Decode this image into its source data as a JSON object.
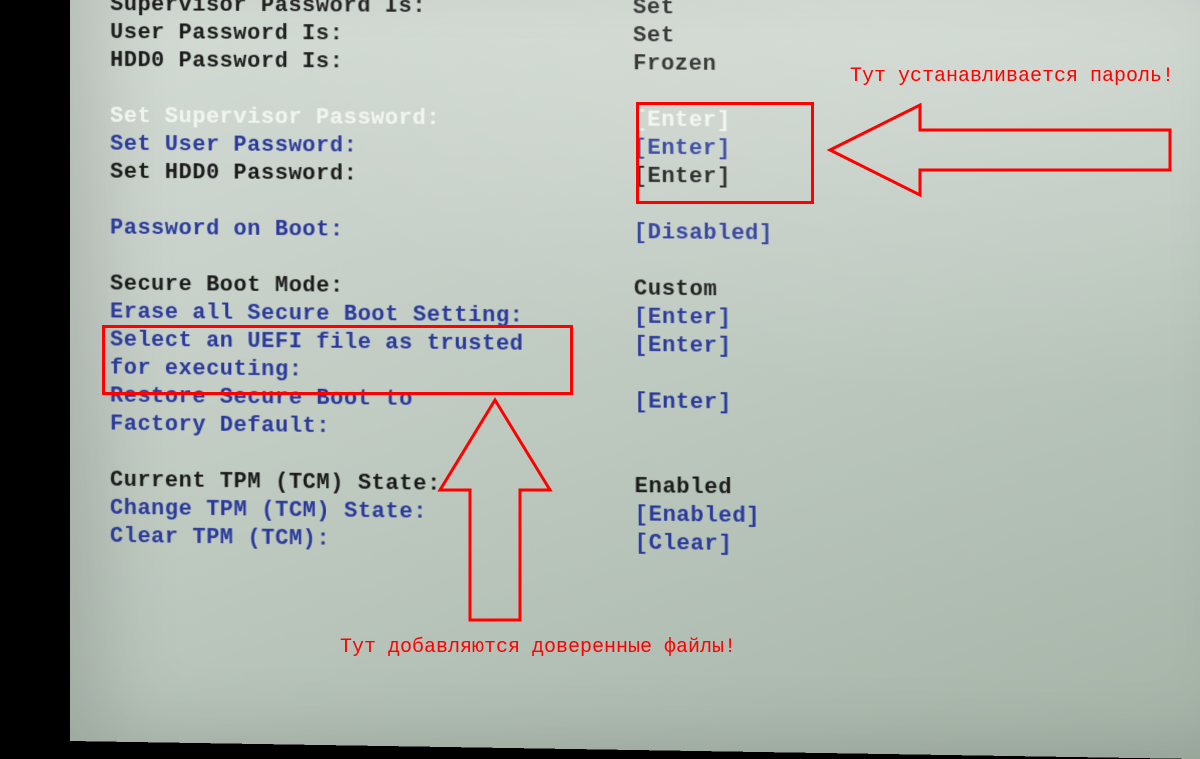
{
  "rows": [
    {
      "label": "Supervisor Password Is:",
      "value": "Set",
      "labelClass": "c-black",
      "valueClass": "c-black"
    },
    {
      "label": "User Password Is:",
      "value": "Set",
      "labelClass": "c-black",
      "valueClass": "c-black"
    },
    {
      "label": "HDD0 Password Is:",
      "value": "Frozen",
      "labelClass": "c-black",
      "valueClass": "c-black"
    },
    {
      "gap": true
    },
    {
      "label": "Set Supervisor Password:",
      "value": "[Enter]",
      "labelClass": "c-white",
      "valueClass": "c-white"
    },
    {
      "label": "Set User Password:",
      "value": "[Enter]",
      "labelClass": "c-blue",
      "valueClass": "c-blue"
    },
    {
      "label": "Set HDD0 Password:",
      "value": "[Enter]",
      "labelClass": "c-black",
      "valueClass": "c-black"
    },
    {
      "gap": true
    },
    {
      "label": "Password on Boot:",
      "value": "[Disabled]",
      "labelClass": "c-blue",
      "valueClass": "c-blue"
    },
    {
      "gap": true
    },
    {
      "label": "Secure Boot Mode:",
      "value": "Custom",
      "labelClass": "c-black",
      "valueClass": "c-black"
    },
    {
      "label": "Erase all Secure Boot Setting:",
      "value": "[Enter]",
      "labelClass": "c-blue",
      "valueClass": "c-blue"
    },
    {
      "label": "Select an UEFI file as trusted",
      "value": "[Enter]",
      "labelClass": "c-blue",
      "valueClass": "c-blue"
    },
    {
      "label": "for executing:",
      "value": "",
      "labelClass": "c-blue",
      "valueClass": "c-blue"
    },
    {
      "label": "Restore Secure Boot to",
      "value": "[Enter]",
      "labelClass": "c-blue",
      "valueClass": "c-blue"
    },
    {
      "label": "Factory Default:",
      "value": "",
      "labelClass": "c-blue",
      "valueClass": "c-blue"
    },
    {
      "gap": true
    },
    {
      "label": "Current TPM (TCM) State:",
      "value": "Enabled",
      "labelClass": "c-black",
      "valueClass": "c-black"
    },
    {
      "label": "Change TPM (TCM) State:",
      "value": "[Enabled]",
      "labelClass": "c-blue",
      "valueClass": "c-blue"
    },
    {
      "label": "Clear TPM (TCM):",
      "value": "[Clear]",
      "labelClass": "c-blue",
      "valueClass": "c-blue"
    }
  ],
  "annotations": {
    "top_text": "Тут устанавливается пароль!",
    "bottom_text": "Тут добавляются доверенные файлы!"
  }
}
